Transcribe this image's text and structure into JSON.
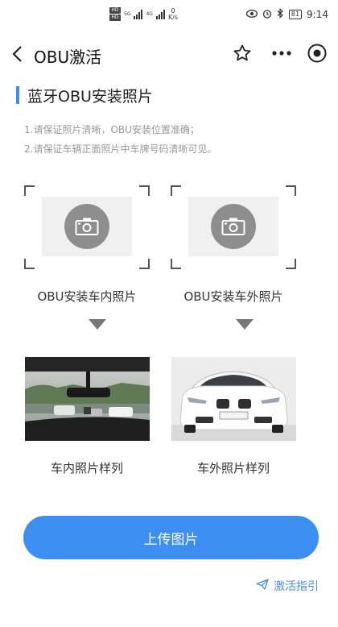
{
  "status_bar": {
    "hd1": "HD",
    "hd2": "HD",
    "net1": "5G",
    "net2": "4G",
    "speed_value": "0",
    "speed_unit": "K/s",
    "battery": "81",
    "time": "9:14"
  },
  "nav": {
    "title": "OBU激活",
    "icons": [
      "back-icon",
      "star-icon",
      "more-icon",
      "target-icon"
    ]
  },
  "section": {
    "title": "蓝牙OBU安装照片",
    "instructions": [
      "1.请保证照片清晰，OBU安装位置准确；",
      "2.请保证车辆正面照片中车牌号码清晰可见。"
    ]
  },
  "uploads": [
    {
      "label": "OBU安装车内照片",
      "icon": "camera-icon"
    },
    {
      "label": "OBU安装车外照片",
      "icon": "camera-icon"
    }
  ],
  "samples": [
    {
      "label": "车内照片样列"
    },
    {
      "label": "车外照片样列"
    }
  ],
  "upload_button": {
    "label": "上传图片"
  },
  "guide_link": {
    "label": "激活指引",
    "icon": "send-icon"
  },
  "colors": {
    "accent": "#3d8ef2",
    "guide_text": "#4a8fe0",
    "instruction_text": "#999999",
    "camera_circle": "#8e8e8e"
  }
}
